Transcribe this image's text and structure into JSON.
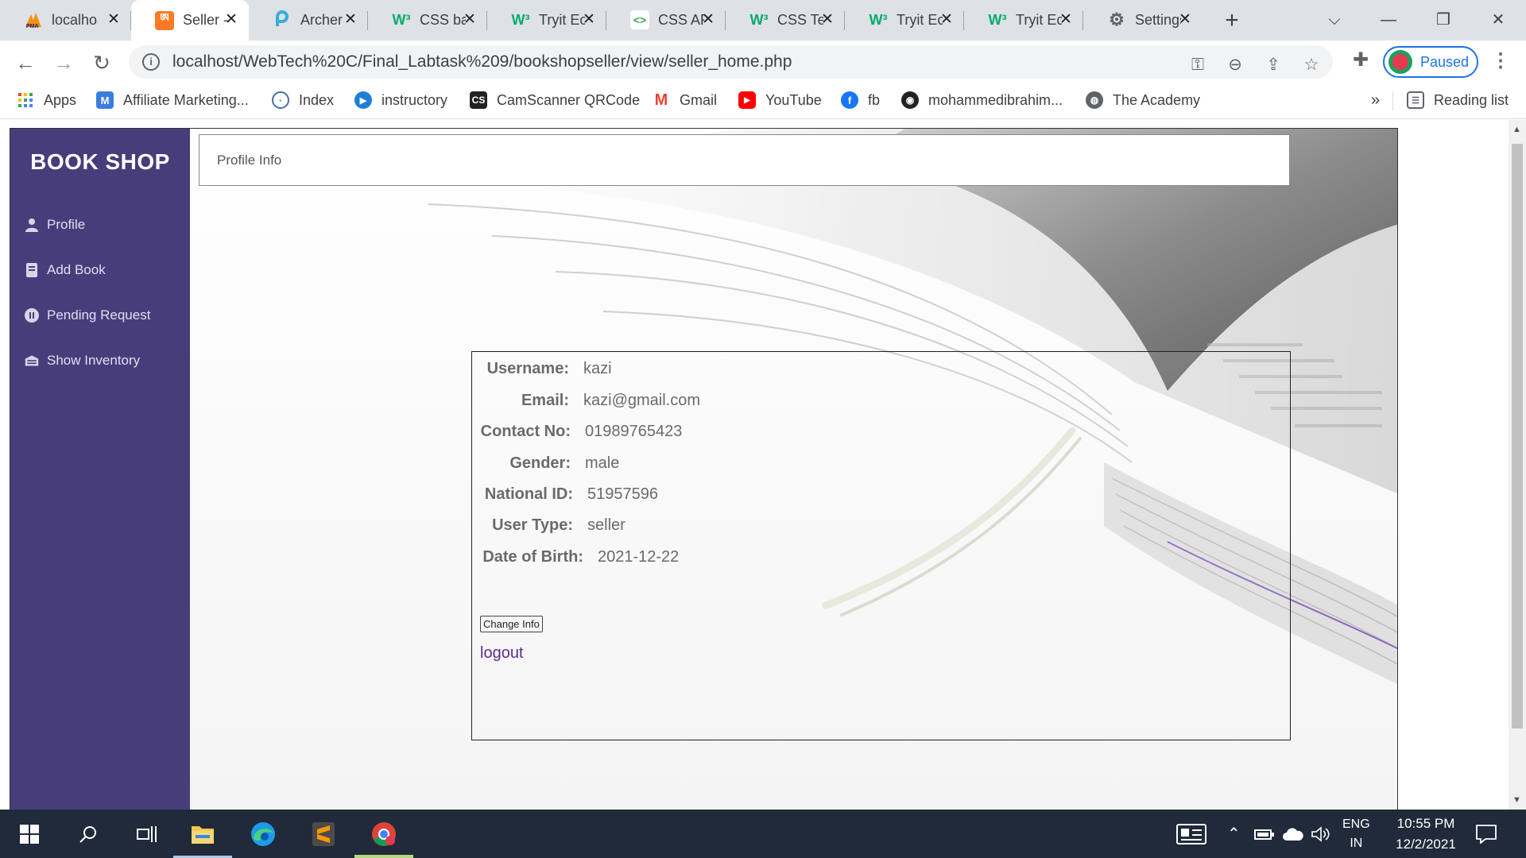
{
  "browser": {
    "tabs": [
      {
        "title": "localhost",
        "icon": "phpmyadmin-icon",
        "active": false
      },
      {
        "title": "Seller - ",
        "icon": "xampp-icon",
        "active": true
      },
      {
        "title": "Archer",
        "icon": "archer-icon",
        "active": false
      },
      {
        "title": "CSS ba",
        "icon": "w3schools-icon",
        "active": false
      },
      {
        "title": "Tryit Ec",
        "icon": "w3schools-icon",
        "active": false
      },
      {
        "title": "CSS AF",
        "icon": "code-icon",
        "active": false
      },
      {
        "title": "CSS Te",
        "icon": "w3schools-icon",
        "active": false
      },
      {
        "title": "Tryit Ec",
        "icon": "w3schools-icon",
        "active": false
      },
      {
        "title": "Tryit Ec",
        "icon": "w3schools-icon",
        "active": false
      },
      {
        "title": "Settings",
        "icon": "gear-icon",
        "active": false
      }
    ],
    "url": "localhost/WebTech%20C/Final_Labtask%209/bookshopseller/view/seller_home.php",
    "profile_status": "Paused",
    "bookmarks": [
      {
        "label": "Apps",
        "icon": "apps-grid-icon"
      },
      {
        "label": "Affiliate Marketing...",
        "icon": "m-icon"
      },
      {
        "label": "Index",
        "icon": "globe-icon"
      },
      {
        "label": "instructory",
        "icon": "play-icon"
      },
      {
        "label": "CamScanner QRCode",
        "icon": "camscanner-icon"
      },
      {
        "label": "Gmail",
        "icon": "gmail-icon"
      },
      {
        "label": "YouTube",
        "icon": "youtube-icon"
      },
      {
        "label": "fb",
        "icon": "facebook-icon"
      },
      {
        "label": "mohammedibrahim...",
        "icon": "github-icon"
      },
      {
        "label": "The Academy",
        "icon": "globe-icon"
      }
    ],
    "more_bookmarks": "»",
    "reading_list": "Reading list"
  },
  "sidebar": {
    "brand": "BOOK SHOP",
    "items": [
      {
        "label": "Profile",
        "icon": "user-icon"
      },
      {
        "label": "Add Book",
        "icon": "book-icon"
      },
      {
        "label": "Pending Request",
        "icon": "pause-circle-icon"
      },
      {
        "label": "Show Inventory",
        "icon": "inventory-icon"
      }
    ]
  },
  "header": {
    "title": "Profile Info"
  },
  "profile": {
    "fields": [
      {
        "label": "Username:",
        "value": "kazi"
      },
      {
        "label": "Email:",
        "value": "kazi@gmail.com"
      },
      {
        "label": "Contact No:",
        "value": "01989765423"
      },
      {
        "label": "Gender:",
        "value": "male"
      },
      {
        "label": "National ID:",
        "value": "51957596"
      },
      {
        "label": "User Type:",
        "value": "seller"
      },
      {
        "label": "Date of Birth:",
        "value": "2021-12-22"
      }
    ],
    "change_button": "Change Info",
    "logout_link": "logout"
  },
  "taskbar": {
    "language": "ENG",
    "region": "IN",
    "time": "10:55 PM",
    "date": "12/2/2021"
  },
  "colors": {
    "sidebar_bg": "#483d7b",
    "accent": "#1a73e8",
    "logout_link": "#5b2e8f",
    "taskbar_bg": "#202a3a"
  }
}
